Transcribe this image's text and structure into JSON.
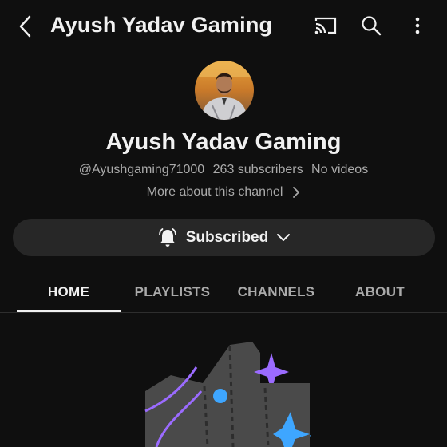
{
  "header": {
    "title": "Ayush Yadav Gaming",
    "icons": [
      "back-arrow-icon",
      "cast-icon",
      "search-icon",
      "more-vert-icon"
    ]
  },
  "channel": {
    "name": "Ayush Yadav Gaming",
    "handle": "@Ayushgaming71000",
    "subscribers": "263 subscribers",
    "videos": "No videos",
    "more_about": "More about this channel"
  },
  "subscribe": {
    "label": "Subscribed",
    "icons": [
      "bell-icon",
      "chevron-down-icon"
    ]
  },
  "tabs": [
    {
      "label": "HOME",
      "active": true
    },
    {
      "label": "PLAYLISTS",
      "active": false
    },
    {
      "label": "CHANNELS",
      "active": false
    },
    {
      "label": "ABOUT",
      "active": false
    }
  ],
  "colors": {
    "background": "#0f0f0f",
    "text_primary": "#f1f1f1",
    "text_secondary": "#aaaaaa",
    "button_bg": "#272727",
    "accent_purple": "#9b6bff",
    "accent_blue": "#3ea6ff"
  }
}
